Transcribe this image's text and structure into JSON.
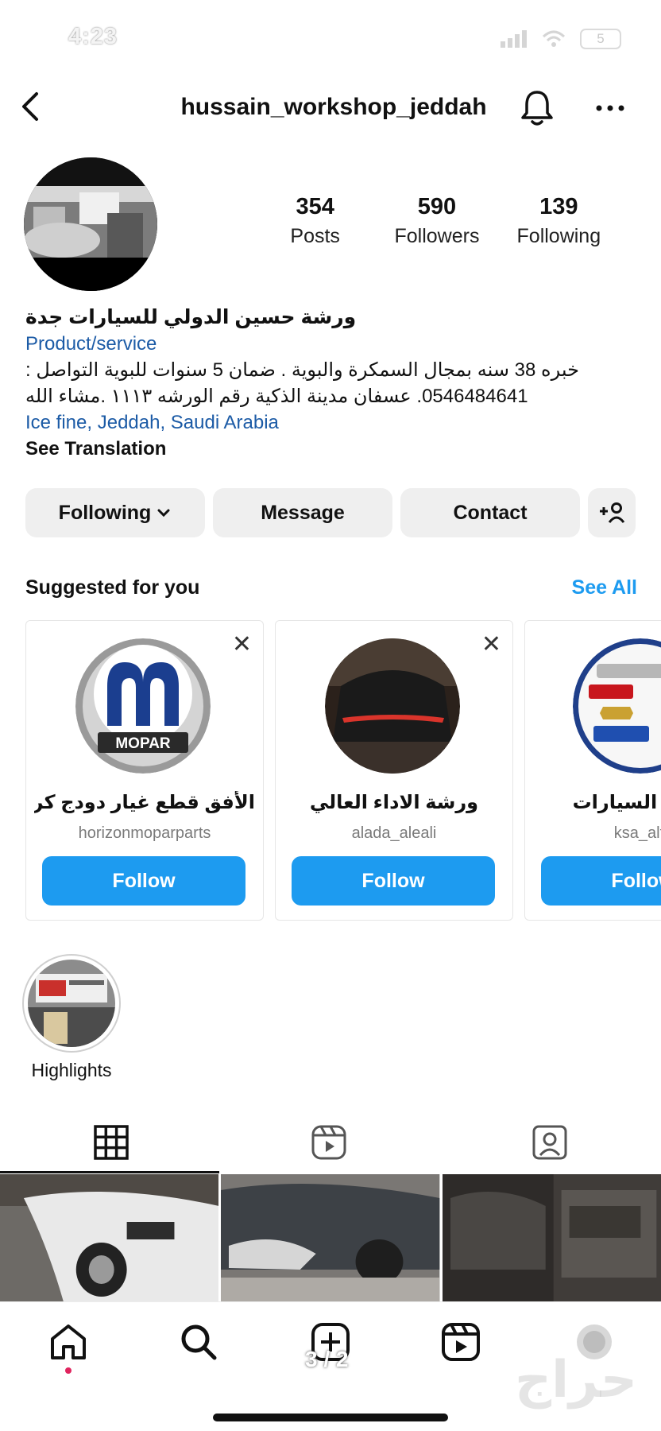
{
  "status_bar": {
    "time": "4:23",
    "battery": "5"
  },
  "header": {
    "username": "hussain_workshop_jeddah"
  },
  "profile": {
    "stats": [
      {
        "value": "354",
        "label": "Posts"
      },
      {
        "value": "590",
        "label": "Followers"
      },
      {
        "value": "139",
        "label": "Following"
      }
    ],
    "display_name": "ورشة حسين الدولي للسيارات جدة",
    "category": "Product/service",
    "bio_line_1": "خبره 38 سنه بمجال السمكرة والبوية . ضمان 5 سنوات للبوية التواصل :",
    "bio_line_2": "0546484641. عسفان مدينة الذكية رقم الورشه ١١١٣ .مشاء الله",
    "location": "Ice fine, Jeddah, Saudi Arabia",
    "see_translation": "See Translation"
  },
  "actions": {
    "following": "Following",
    "message": "Message",
    "contact": "Contact"
  },
  "suggested": {
    "title": "Suggested for you",
    "see_all": "See All",
    "cards": [
      {
        "name": "الأفق قطع غيار دودج كرا...",
        "handle": "horizonmoparparts",
        "follow": "Follow",
        "logo_text": "MOPAR"
      },
      {
        "name": "ورشة الاداء العالي",
        "handle": "alada_aleali",
        "follow": "Follow"
      },
      {
        "name": "صيانة السيارات",
        "handle": "ksa_alto",
        "follow": "Follow"
      }
    ]
  },
  "highlights": [
    {
      "label": "Highlights"
    }
  ],
  "footer": {
    "page_indicator": "3 / 2",
    "watermark": "حراج"
  },
  "colors": {
    "accent": "#1d9bf0",
    "link": "#1c5ba6",
    "button_bg": "#efefef"
  }
}
